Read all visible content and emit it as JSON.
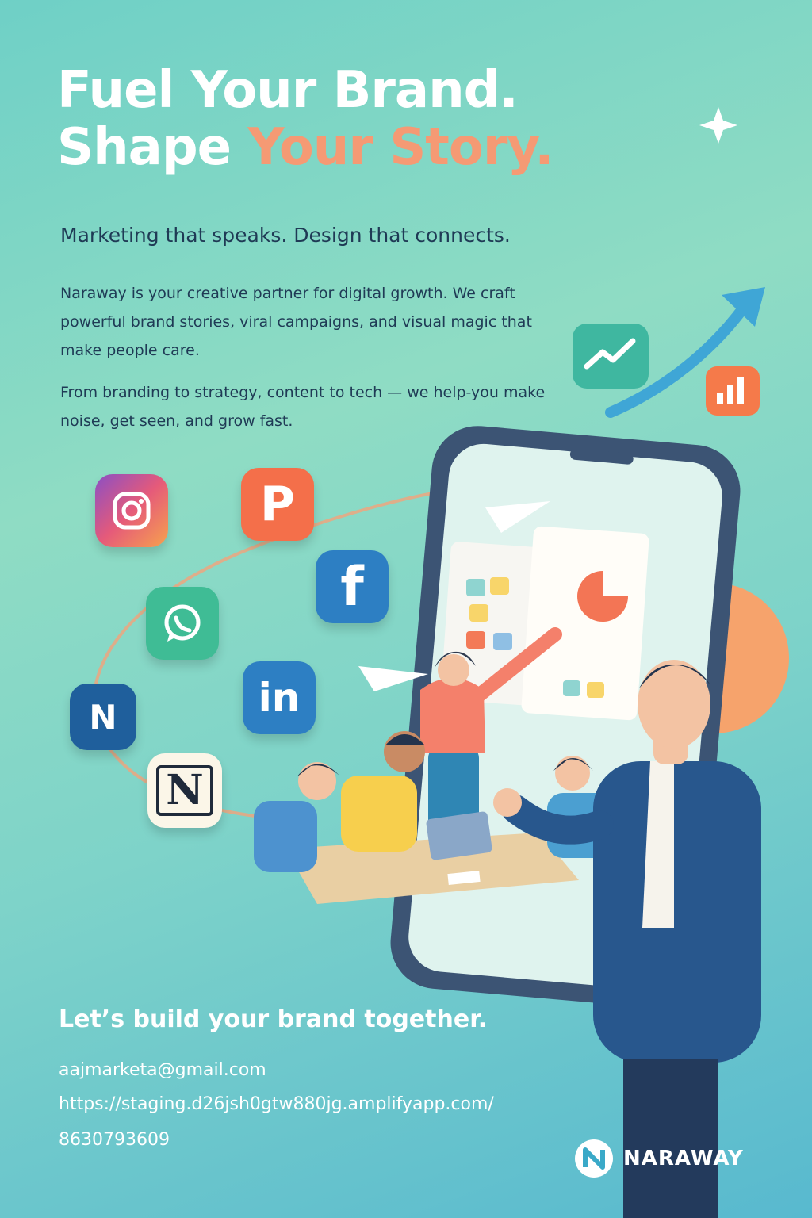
{
  "hero": {
    "line1": "Fuel Your Brand.",
    "line2_white": "Shape ",
    "line2_accent": "Your Story."
  },
  "tagline": "Marketing that speaks. Design that connects.",
  "paragraphs": [
    "Naraway is your creative partner for digital growth. We craft powerful brand stories, viral campaigns, and visual magic that make people care.",
    "From branding to strategy, content to tech — we help-you make noise, get seen, and grow fast."
  ],
  "cta": "Let’s build your brand together.",
  "contact": {
    "email": "aajmarketa@gmail.com",
    "website": "https://staging.d26jsh0gtw880jg.amplifyapp.com/",
    "phone": "8630793609"
  },
  "brand": {
    "name": "NARAWAY"
  },
  "icons": [
    "instagram-icon",
    "pinterest-icon",
    "facebook-icon",
    "whatsapp-icon",
    "linkedin-icon",
    "n-brand-icon",
    "notion-icon",
    "trend-chart-icon",
    "bar-chart-icon",
    "growth-arrow-icon",
    "sparkle-icon",
    "paper-plane-icon"
  ],
  "colors": {
    "accent": "#f59a74",
    "text_dark": "#1f3a55",
    "bg_teal": "#7ed3c9"
  }
}
